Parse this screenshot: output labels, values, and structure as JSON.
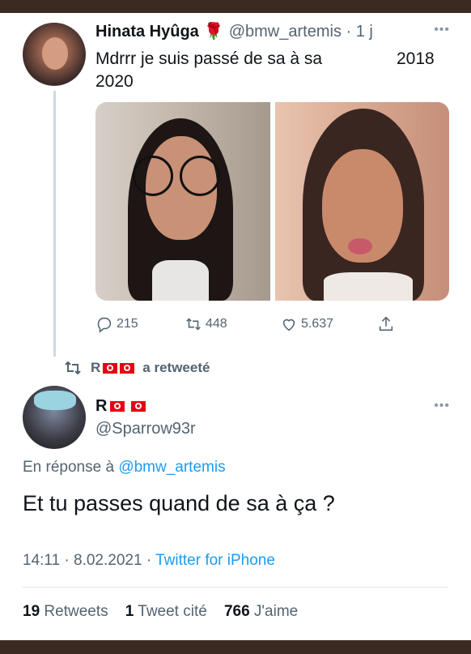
{
  "original_tweet": {
    "display_name": "Hinata Hyûga",
    "name_emoji": "🌹",
    "handle_time": "@bmw_artemis · 1 j",
    "text_line1": "Mdrrr je suis passé de sa à sa",
    "text_year1": "2018",
    "text_line2": "2020",
    "actions": {
      "replies": "215",
      "retweets": "448",
      "likes": "5.637"
    }
  },
  "retweet_notice": {
    "retweeter": "R",
    "label": "a retweeté"
  },
  "reply_tweet": {
    "display_name": "R",
    "handle": "@Sparrow93r",
    "reply_prefix": "En réponse à",
    "reply_to": "@bmw_artemis",
    "text": "Et tu passes quand de sa à ça ?",
    "time_date": "14:11 · 8.02.2021 ·",
    "source": "Twitter for iPhone",
    "stats": {
      "retweets_count": "19",
      "retweets_label": "Retweets",
      "quotes_count": "1",
      "quotes_label": "Tweet cité",
      "likes_count": "766",
      "likes_label": "J'aime"
    }
  },
  "colors": {
    "link": "#1d9bf0",
    "secondary_text": "#536471",
    "flag_red": "#e70013"
  },
  "icons": [
    "reply-icon",
    "retweet-icon",
    "like-icon",
    "share-icon",
    "more-icon",
    "tunisia-flag-icon",
    "rose-icon"
  ]
}
